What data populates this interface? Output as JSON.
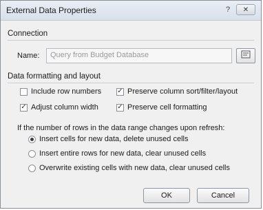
{
  "dialog": {
    "title": "External Data Properties",
    "help_glyph": "?",
    "close_glyph": "✕"
  },
  "connection": {
    "section_label": "Connection",
    "name_label": "Name:",
    "name_value": "Query from Budget Database"
  },
  "formatting": {
    "section_label": "Data formatting and layout",
    "checkboxes": [
      {
        "label": "Include row numbers",
        "checked": false
      },
      {
        "label": "Preserve column sort/filter/layout",
        "checked": true
      },
      {
        "label": "Adjust column width",
        "checked": true
      },
      {
        "label": "Preserve cell formatting",
        "checked": true
      }
    ]
  },
  "refresh": {
    "question": "If the number of rows in the data range changes upon refresh:",
    "options": [
      {
        "label": "Insert cells for new data, delete unused cells",
        "selected": true
      },
      {
        "label": "Insert entire rows for new data, clear unused cells",
        "selected": false
      },
      {
        "label": "Overwrite existing cells with new data, clear unused cells",
        "selected": false
      }
    ]
  },
  "buttons": {
    "ok": "OK",
    "cancel": "Cancel"
  }
}
